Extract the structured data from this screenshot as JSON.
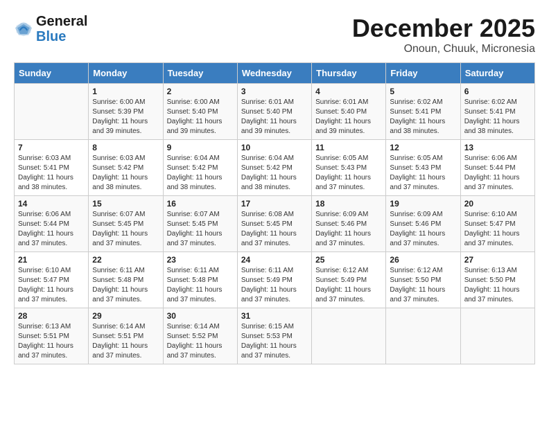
{
  "header": {
    "logo_line1": "General",
    "logo_line2": "Blue",
    "month_title": "December 2025",
    "location": "Onoun, Chuuk, Micronesia"
  },
  "days_of_week": [
    "Sunday",
    "Monday",
    "Tuesday",
    "Wednesday",
    "Thursday",
    "Friday",
    "Saturday"
  ],
  "weeks": [
    [
      {
        "day": "",
        "sunrise": "",
        "sunset": "",
        "daylight": ""
      },
      {
        "day": "1",
        "sunrise": "Sunrise: 6:00 AM",
        "sunset": "Sunset: 5:39 PM",
        "daylight": "Daylight: 11 hours and 39 minutes."
      },
      {
        "day": "2",
        "sunrise": "Sunrise: 6:00 AM",
        "sunset": "Sunset: 5:40 PM",
        "daylight": "Daylight: 11 hours and 39 minutes."
      },
      {
        "day": "3",
        "sunrise": "Sunrise: 6:01 AM",
        "sunset": "Sunset: 5:40 PM",
        "daylight": "Daylight: 11 hours and 39 minutes."
      },
      {
        "day": "4",
        "sunrise": "Sunrise: 6:01 AM",
        "sunset": "Sunset: 5:40 PM",
        "daylight": "Daylight: 11 hours and 39 minutes."
      },
      {
        "day": "5",
        "sunrise": "Sunrise: 6:02 AM",
        "sunset": "Sunset: 5:41 PM",
        "daylight": "Daylight: 11 hours and 38 minutes."
      },
      {
        "day": "6",
        "sunrise": "Sunrise: 6:02 AM",
        "sunset": "Sunset: 5:41 PM",
        "daylight": "Daylight: 11 hours and 38 minutes."
      }
    ],
    [
      {
        "day": "7",
        "sunrise": "Sunrise: 6:03 AM",
        "sunset": "Sunset: 5:41 PM",
        "daylight": "Daylight: 11 hours and 38 minutes."
      },
      {
        "day": "8",
        "sunrise": "Sunrise: 6:03 AM",
        "sunset": "Sunset: 5:42 PM",
        "daylight": "Daylight: 11 hours and 38 minutes."
      },
      {
        "day": "9",
        "sunrise": "Sunrise: 6:04 AM",
        "sunset": "Sunset: 5:42 PM",
        "daylight": "Daylight: 11 hours and 38 minutes."
      },
      {
        "day": "10",
        "sunrise": "Sunrise: 6:04 AM",
        "sunset": "Sunset: 5:42 PM",
        "daylight": "Daylight: 11 hours and 38 minutes."
      },
      {
        "day": "11",
        "sunrise": "Sunrise: 6:05 AM",
        "sunset": "Sunset: 5:43 PM",
        "daylight": "Daylight: 11 hours and 37 minutes."
      },
      {
        "day": "12",
        "sunrise": "Sunrise: 6:05 AM",
        "sunset": "Sunset: 5:43 PM",
        "daylight": "Daylight: 11 hours and 37 minutes."
      },
      {
        "day": "13",
        "sunrise": "Sunrise: 6:06 AM",
        "sunset": "Sunset: 5:44 PM",
        "daylight": "Daylight: 11 hours and 37 minutes."
      }
    ],
    [
      {
        "day": "14",
        "sunrise": "Sunrise: 6:06 AM",
        "sunset": "Sunset: 5:44 PM",
        "daylight": "Daylight: 11 hours and 37 minutes."
      },
      {
        "day": "15",
        "sunrise": "Sunrise: 6:07 AM",
        "sunset": "Sunset: 5:45 PM",
        "daylight": "Daylight: 11 hours and 37 minutes."
      },
      {
        "day": "16",
        "sunrise": "Sunrise: 6:07 AM",
        "sunset": "Sunset: 5:45 PM",
        "daylight": "Daylight: 11 hours and 37 minutes."
      },
      {
        "day": "17",
        "sunrise": "Sunrise: 6:08 AM",
        "sunset": "Sunset: 5:45 PM",
        "daylight": "Daylight: 11 hours and 37 minutes."
      },
      {
        "day": "18",
        "sunrise": "Sunrise: 6:09 AM",
        "sunset": "Sunset: 5:46 PM",
        "daylight": "Daylight: 11 hours and 37 minutes."
      },
      {
        "day": "19",
        "sunrise": "Sunrise: 6:09 AM",
        "sunset": "Sunset: 5:46 PM",
        "daylight": "Daylight: 11 hours and 37 minutes."
      },
      {
        "day": "20",
        "sunrise": "Sunrise: 6:10 AM",
        "sunset": "Sunset: 5:47 PM",
        "daylight": "Daylight: 11 hours and 37 minutes."
      }
    ],
    [
      {
        "day": "21",
        "sunrise": "Sunrise: 6:10 AM",
        "sunset": "Sunset: 5:47 PM",
        "daylight": "Daylight: 11 hours and 37 minutes."
      },
      {
        "day": "22",
        "sunrise": "Sunrise: 6:11 AM",
        "sunset": "Sunset: 5:48 PM",
        "daylight": "Daylight: 11 hours and 37 minutes."
      },
      {
        "day": "23",
        "sunrise": "Sunrise: 6:11 AM",
        "sunset": "Sunset: 5:48 PM",
        "daylight": "Daylight: 11 hours and 37 minutes."
      },
      {
        "day": "24",
        "sunrise": "Sunrise: 6:11 AM",
        "sunset": "Sunset: 5:49 PM",
        "daylight": "Daylight: 11 hours and 37 minutes."
      },
      {
        "day": "25",
        "sunrise": "Sunrise: 6:12 AM",
        "sunset": "Sunset: 5:49 PM",
        "daylight": "Daylight: 11 hours and 37 minutes."
      },
      {
        "day": "26",
        "sunrise": "Sunrise: 6:12 AM",
        "sunset": "Sunset: 5:50 PM",
        "daylight": "Daylight: 11 hours and 37 minutes."
      },
      {
        "day": "27",
        "sunrise": "Sunrise: 6:13 AM",
        "sunset": "Sunset: 5:50 PM",
        "daylight": "Daylight: 11 hours and 37 minutes."
      }
    ],
    [
      {
        "day": "28",
        "sunrise": "Sunrise: 6:13 AM",
        "sunset": "Sunset: 5:51 PM",
        "daylight": "Daylight: 11 hours and 37 minutes."
      },
      {
        "day": "29",
        "sunrise": "Sunrise: 6:14 AM",
        "sunset": "Sunset: 5:51 PM",
        "daylight": "Daylight: 11 hours and 37 minutes."
      },
      {
        "day": "30",
        "sunrise": "Sunrise: 6:14 AM",
        "sunset": "Sunset: 5:52 PM",
        "daylight": "Daylight: 11 hours and 37 minutes."
      },
      {
        "day": "31",
        "sunrise": "Sunrise: 6:15 AM",
        "sunset": "Sunset: 5:53 PM",
        "daylight": "Daylight: 11 hours and 37 minutes."
      },
      {
        "day": "",
        "sunrise": "",
        "sunset": "",
        "daylight": ""
      },
      {
        "day": "",
        "sunrise": "",
        "sunset": "",
        "daylight": ""
      },
      {
        "day": "",
        "sunrise": "",
        "sunset": "",
        "daylight": ""
      }
    ]
  ]
}
